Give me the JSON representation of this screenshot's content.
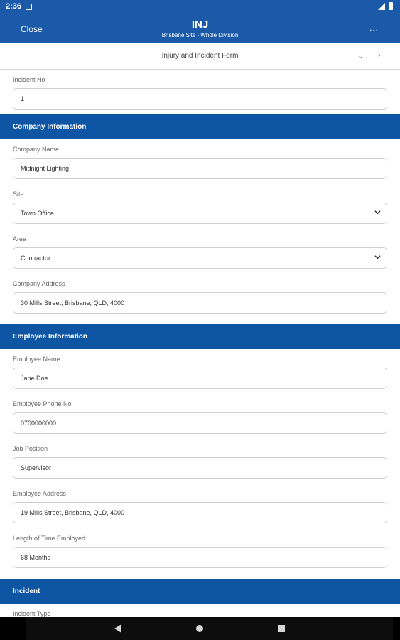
{
  "status": {
    "time": "2:36"
  },
  "appbar": {
    "close_label": "Close",
    "title": "INJ",
    "subtitle": "Brisbane Site - Whole Division",
    "more_label": "..."
  },
  "formnav": {
    "name": "Injury and Incident Form",
    "down": "⌄",
    "next": "›"
  },
  "incident_no": {
    "label": "Incident No",
    "value": "1"
  },
  "company": {
    "header": "Company Information",
    "name": {
      "label": "Company Name",
      "value": "Midnight Lighting"
    },
    "site": {
      "label": "Site",
      "value": "Town Office"
    },
    "area": {
      "label": "Area",
      "value": "Contractor"
    },
    "address": {
      "label": "Company Address",
      "value": "30 Mills Street, Brisbane, QLD, 4000"
    }
  },
  "employee": {
    "header": "Employee Information",
    "name": {
      "label": "Employee Name",
      "value": "Jane Doe"
    },
    "phone": {
      "label": "Employee Phone No",
      "value": "0700000000"
    },
    "position": {
      "label": "Job Position",
      "value": "Supervisor"
    },
    "address": {
      "label": "Employee Address",
      "value": "19 Mills Street, Brisbane, QLD, 4000"
    },
    "length": {
      "label": "Length of Time Employed",
      "value": "68 Months"
    }
  },
  "incident": {
    "header": "Incident",
    "type": {
      "label": "Incident Type"
    }
  },
  "icons": {
    "back": "back-icon",
    "home": "home-icon",
    "recent": "recents-icon",
    "dropdown": "chevron-down-icon"
  },
  "colors": {
    "primary": "#1b5aa8",
    "section": "#0e55a4"
  }
}
